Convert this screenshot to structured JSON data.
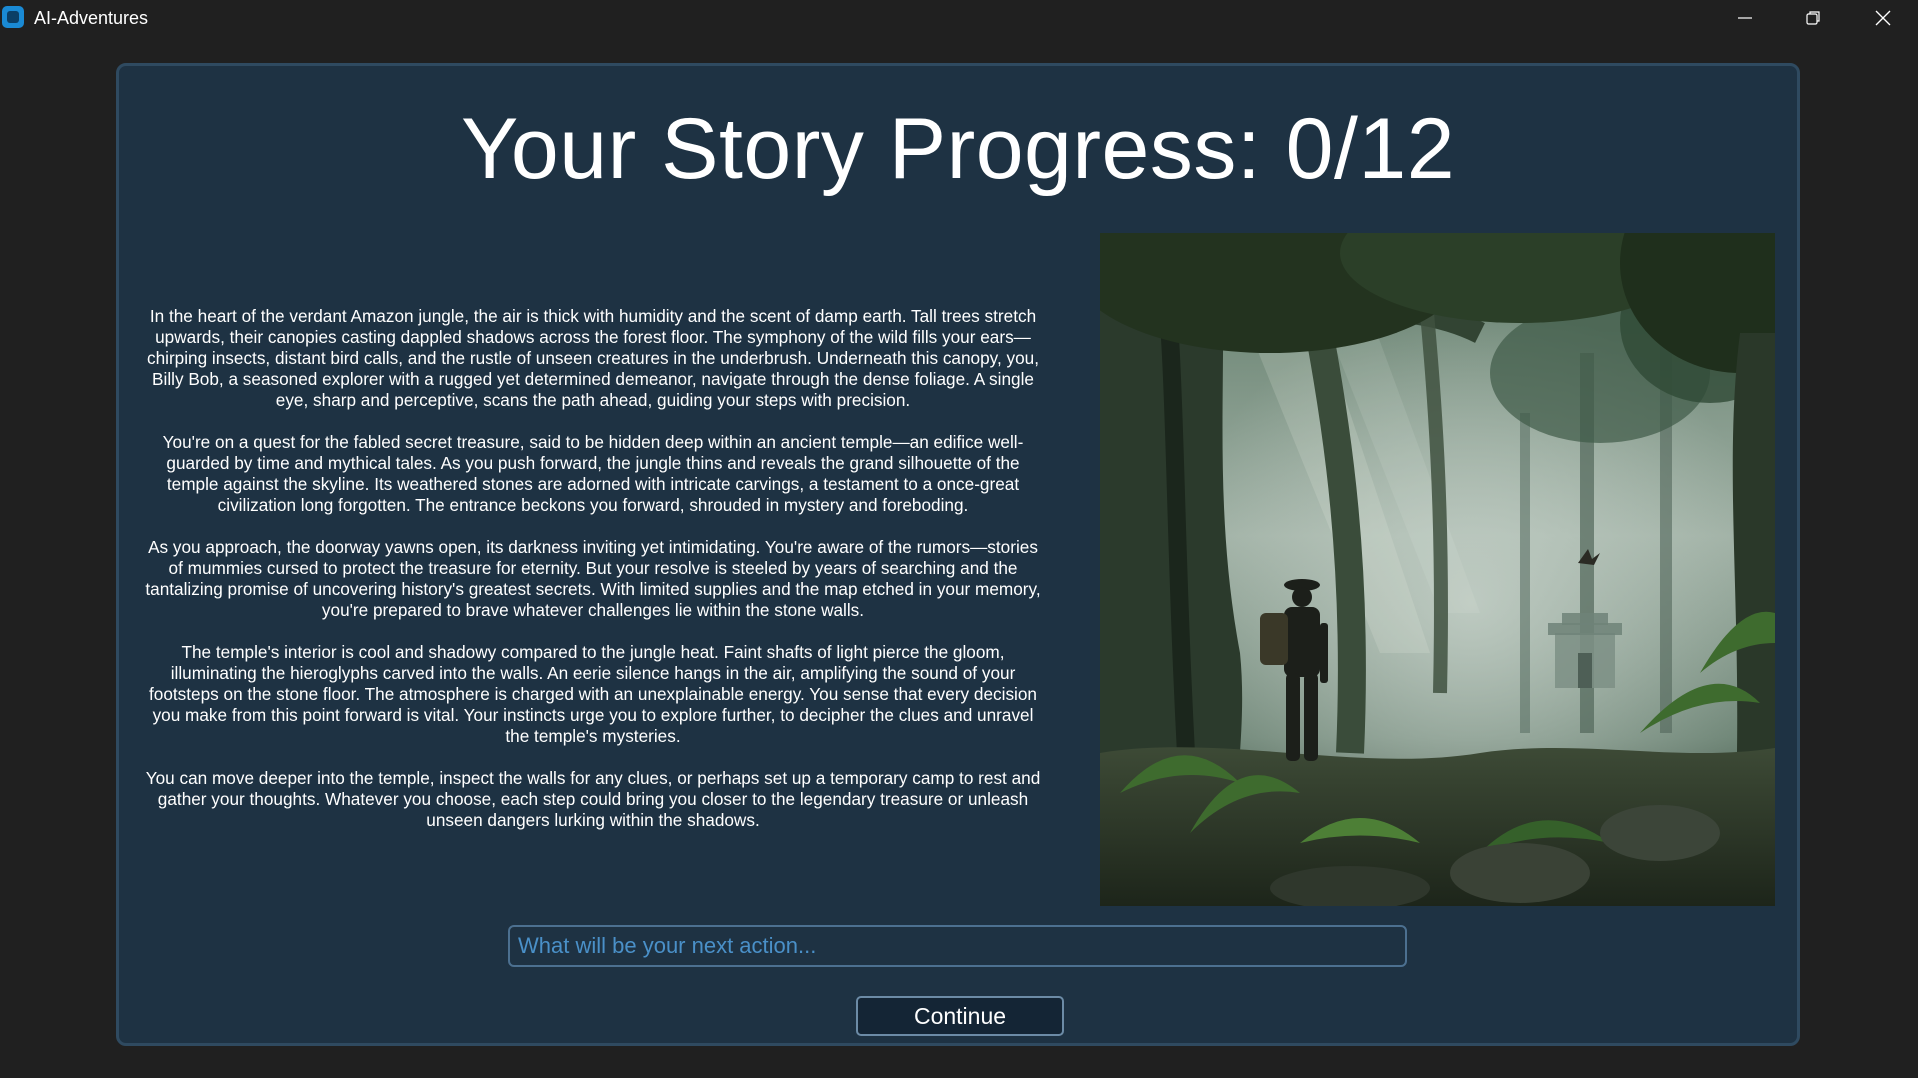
{
  "window": {
    "title": "AI-Adventures",
    "controls": [
      "minimize-icon",
      "restore-icon",
      "close-icon"
    ]
  },
  "header": {
    "title": "Your Story Progress: 0/12"
  },
  "story": {
    "paragraphs": [
      "In the heart of the verdant Amazon jungle, the air is thick with humidity and the scent of damp earth. Tall trees stretch upwards, their canopies casting dappled shadows across the forest floor. The symphony of the wild fills your ears—chirping insects, distant bird calls, and the rustle of unseen creatures in the underbrush. Underneath this canopy, you, Billy Bob, a seasoned explorer with a rugged yet determined demeanor, navigate through the dense foliage. A single eye, sharp and perceptive, scans the path ahead, guiding your steps with precision.",
      "You're on a quest for the fabled secret treasure, said to be hidden deep within an ancient temple—an edifice well-guarded by time and mythical tales. As you push forward, the jungle thins and reveals the grand silhouette of the temple against the skyline. Its weathered stones are adorned with intricate carvings, a testament to a once-great civilization long forgotten. The entrance beckons you forward, shrouded in mystery and foreboding.",
      "As you approach, the doorway yawns open, its darkness inviting yet intimidating. You're aware of the rumors—stories of mummies cursed to protect the treasure for eternity. But your resolve is steeled by years of searching and the tantalizing promise of uncovering history's greatest secrets. With limited supplies and the map etched in your memory, you're prepared to brave whatever challenges lie within the stone walls.",
      "The temple's interior is cool and shadowy compared to the jungle heat. Faint shafts of light pierce the gloom, illuminating the hieroglyphs carved into the walls. An eerie silence hangs in the air, amplifying the sound of your footsteps on the stone floor. The atmosphere is charged with an unexplainable energy. You sense that every decision you make from this point forward is vital. Your instincts urge you to explore further, to decipher the clues and unravel the temple's mysteries.",
      "You can move deeper into the temple, inspect the walls for any clues, or perhaps set up a temporary camp to rest and gather your thoughts. Whatever you choose, each step could bring you closer to the legendary treasure or unleash unseen dangers lurking within the shadows."
    ]
  },
  "scene_image": {
    "icon": "jungle-explorer-illustration"
  },
  "action": {
    "placeholder": "What will be your next action...",
    "value": ""
  },
  "continue_button": {
    "label": "Continue"
  },
  "colors": {
    "background": "#202020",
    "panel": "#1e3243",
    "panel_border": "#2f4a60",
    "placeholder": "#4a90c8",
    "text": "#ffffff"
  }
}
